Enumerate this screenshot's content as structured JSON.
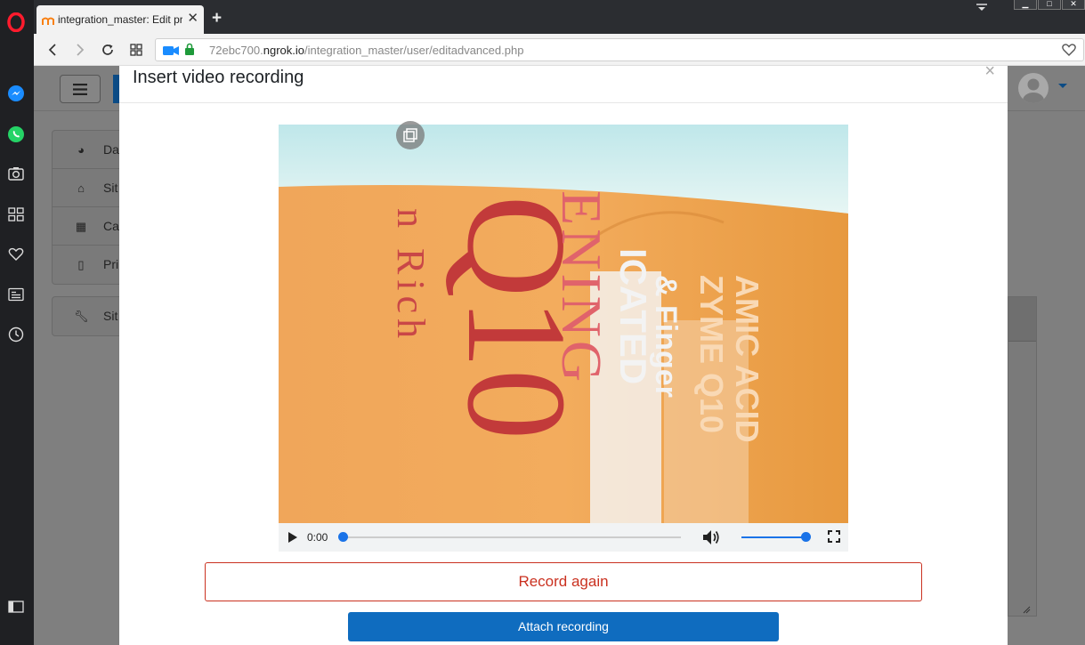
{
  "browser": {
    "tab_title": "integration_master: Edit pro",
    "url_prefix": "72ebc700.",
    "url_domain": "ngrok.io",
    "url_path": "/integration_master/user/editadvanced.php",
    "accent_color": "#ff1b2d"
  },
  "nav": {
    "card1": [
      {
        "label": "Da",
        "icon": "dashboard-icon"
      },
      {
        "label": "Sit",
        "icon": "home-icon"
      },
      {
        "label": "Ca",
        "icon": "calendar-icon"
      },
      {
        "label": "Pri",
        "icon": "file-icon"
      }
    ],
    "card2": [
      {
        "label": "Sit",
        "icon": "wrench-icon"
      }
    ]
  },
  "modal": {
    "title": "Insert video recording",
    "close_glyph": "×",
    "video": {
      "time": "0:00",
      "progress": 0.0,
      "volume": 1.0,
      "frame_text": {
        "word_rich": "n Rich",
        "q10": "Q10",
        "ening": "ENING",
        "icated": "ICATED",
        "finger": "& Finger",
        "zyme": "ZYME Q10",
        "amic": "AMIC ACID"
      }
    },
    "record_again_label": "Record again",
    "attach_label": "Attach recording"
  },
  "colors": {
    "primary": "#0f6cbf",
    "danger": "#ca3120"
  }
}
